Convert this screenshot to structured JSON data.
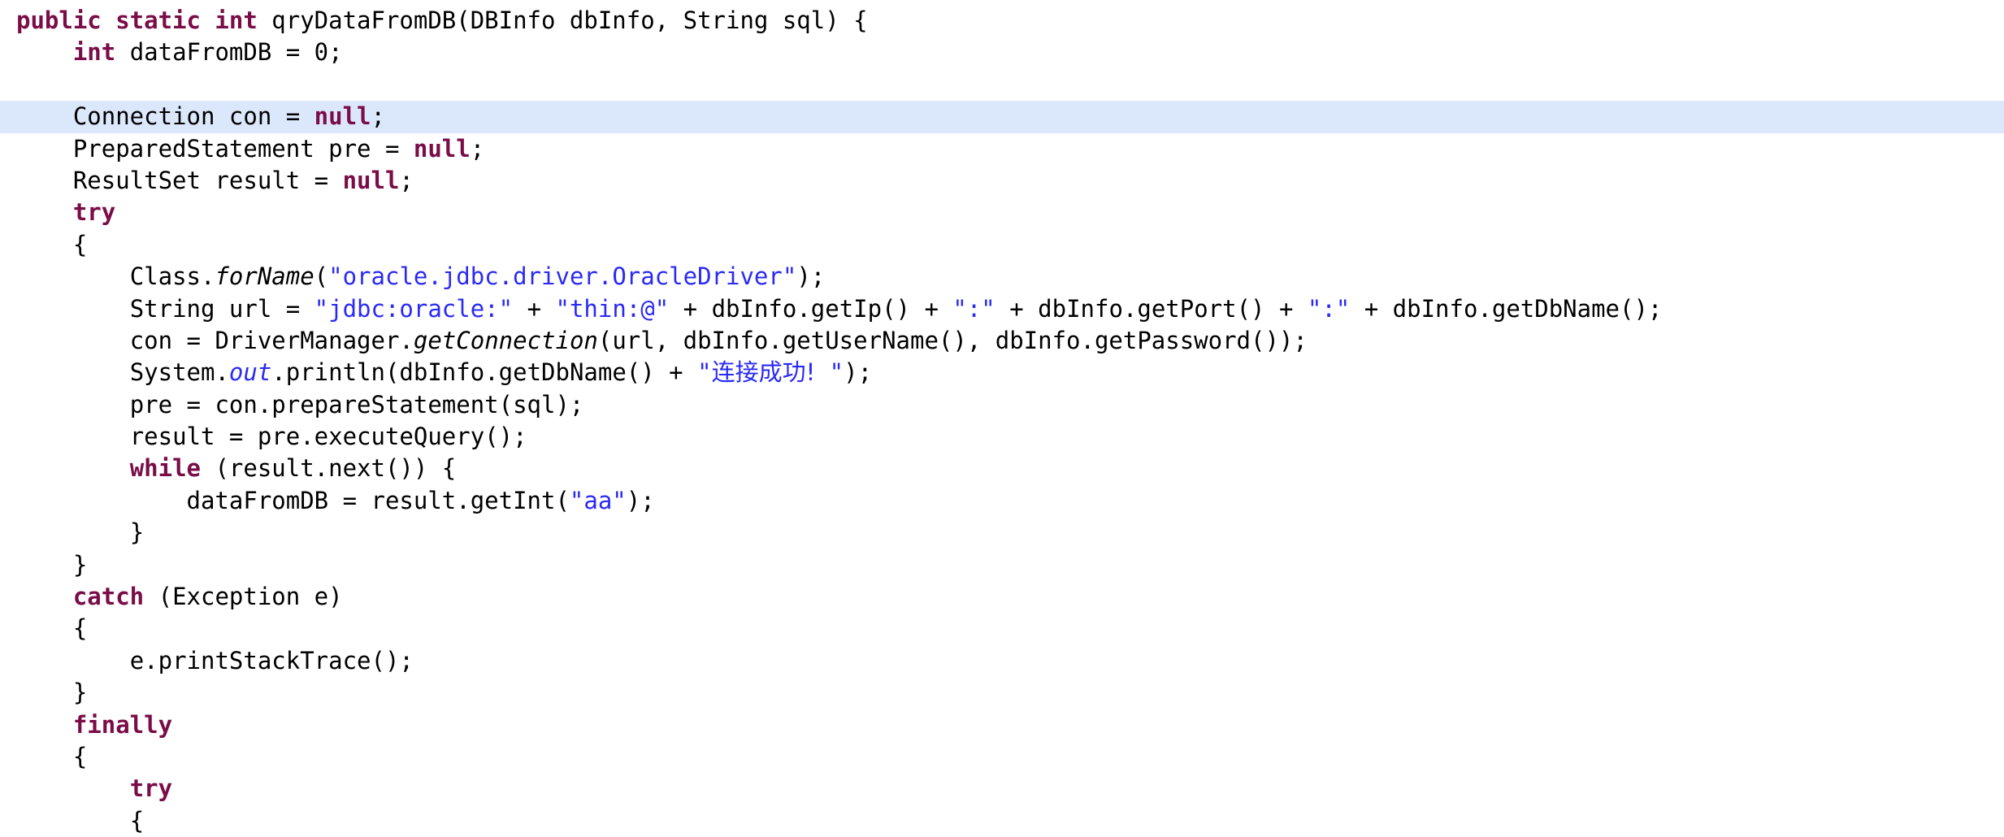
{
  "editor": {
    "language": "Java",
    "method_name": "qryDataFromDB",
    "highlight_color": "#dbe8fb",
    "keyword_color": "#7a0d48",
    "string_color": "#2a2af5",
    "text_color": "#000000",
    "background_color": "#ffffff",
    "highlighted_line_index": 3
  },
  "code": {
    "lines": [
      {
        "index": 0,
        "indent": 0,
        "highlighted": false,
        "segments": [
          {
            "type": "kw",
            "text": "public static int "
          },
          {
            "type": "plain",
            "text": "qryDataFromDB(DBInfo dbInfo, String sql) {"
          }
        ]
      },
      {
        "index": 1,
        "indent": 1,
        "highlighted": false,
        "segments": [
          {
            "type": "kw",
            "text": "int "
          },
          {
            "type": "plain",
            "text": "dataFromDB = 0;"
          }
        ]
      },
      {
        "index": 2,
        "indent": 0,
        "highlighted": false,
        "segments": [
          {
            "type": "plain",
            "text": ""
          }
        ]
      },
      {
        "index": 3,
        "indent": 1,
        "highlighted": true,
        "segments": [
          {
            "type": "plain",
            "text": "Connection con = "
          },
          {
            "type": "kw",
            "text": "null"
          },
          {
            "type": "plain",
            "text": ";"
          }
        ]
      },
      {
        "index": 4,
        "indent": 1,
        "highlighted": false,
        "segments": [
          {
            "type": "plain",
            "text": "PreparedStatement pre = "
          },
          {
            "type": "kw",
            "text": "null"
          },
          {
            "type": "plain",
            "text": ";"
          }
        ]
      },
      {
        "index": 5,
        "indent": 1,
        "highlighted": false,
        "segments": [
          {
            "type": "plain",
            "text": "ResultSet result = "
          },
          {
            "type": "kw",
            "text": "null"
          },
          {
            "type": "plain",
            "text": ";"
          }
        ]
      },
      {
        "index": 6,
        "indent": 1,
        "highlighted": false,
        "segments": [
          {
            "type": "kw",
            "text": "try"
          }
        ]
      },
      {
        "index": 7,
        "indent": 1,
        "highlighted": false,
        "segments": [
          {
            "type": "plain",
            "text": "{"
          }
        ]
      },
      {
        "index": 8,
        "indent": 2,
        "highlighted": false,
        "segments": [
          {
            "type": "plain",
            "text": "Class."
          },
          {
            "type": "method-italic",
            "text": "forName"
          },
          {
            "type": "plain",
            "text": "("
          },
          {
            "type": "str",
            "text": "\"oracle.jdbc.driver.OracleDriver\""
          },
          {
            "type": "plain",
            "text": ");"
          }
        ]
      },
      {
        "index": 9,
        "indent": 2,
        "highlighted": false,
        "segments": [
          {
            "type": "plain",
            "text": "String url = "
          },
          {
            "type": "str",
            "text": "\"jdbc:oracle:\""
          },
          {
            "type": "plain",
            "text": " + "
          },
          {
            "type": "str",
            "text": "\"thin:@\""
          },
          {
            "type": "plain",
            "text": " + dbInfo.getIp() + "
          },
          {
            "type": "str",
            "text": "\":\""
          },
          {
            "type": "plain",
            "text": " + dbInfo.getPort() + "
          },
          {
            "type": "str",
            "text": "\":\""
          },
          {
            "type": "plain",
            "text": " + dbInfo.getDbName();"
          }
        ]
      },
      {
        "index": 10,
        "indent": 2,
        "highlighted": false,
        "segments": [
          {
            "type": "plain",
            "text": "con = DriverManager."
          },
          {
            "type": "method-italic",
            "text": "getConnection"
          },
          {
            "type": "plain",
            "text": "(url, dbInfo.getUserName(), dbInfo.getPassword());"
          }
        ]
      },
      {
        "index": 11,
        "indent": 2,
        "highlighted": false,
        "segments": [
          {
            "type": "plain",
            "text": "System."
          },
          {
            "type": "static",
            "text": "out"
          },
          {
            "type": "plain",
            "text": ".println(dbInfo.getDbName() + "
          },
          {
            "type": "str",
            "text": "\""
          },
          {
            "type": "cjk",
            "text": "连接成功!"
          },
          {
            "type": "str",
            "text": " \""
          },
          {
            "type": "plain",
            "text": ");"
          }
        ]
      },
      {
        "index": 12,
        "indent": 2,
        "highlighted": false,
        "segments": [
          {
            "type": "plain",
            "text": "pre = con.prepareStatement(sql);"
          }
        ]
      },
      {
        "index": 13,
        "indent": 2,
        "highlighted": false,
        "segments": [
          {
            "type": "plain",
            "text": "result = pre.executeQuery();"
          }
        ]
      },
      {
        "index": 14,
        "indent": 2,
        "highlighted": false,
        "segments": [
          {
            "type": "kw",
            "text": "while"
          },
          {
            "type": "plain",
            "text": " (result.next()) {"
          }
        ]
      },
      {
        "index": 15,
        "indent": 3,
        "highlighted": false,
        "segments": [
          {
            "type": "plain",
            "text": "dataFromDB = result.getInt("
          },
          {
            "type": "str",
            "text": "\"aa\""
          },
          {
            "type": "plain",
            "text": ");"
          }
        ]
      },
      {
        "index": 16,
        "indent": 2,
        "highlighted": false,
        "segments": [
          {
            "type": "plain",
            "text": "}"
          }
        ]
      },
      {
        "index": 17,
        "indent": 1,
        "highlighted": false,
        "segments": [
          {
            "type": "plain",
            "text": "}"
          }
        ]
      },
      {
        "index": 18,
        "indent": 1,
        "highlighted": false,
        "segments": [
          {
            "type": "kw",
            "text": "catch"
          },
          {
            "type": "plain",
            "text": " (Exception e)"
          }
        ]
      },
      {
        "index": 19,
        "indent": 1,
        "highlighted": false,
        "segments": [
          {
            "type": "plain",
            "text": "{"
          }
        ]
      },
      {
        "index": 20,
        "indent": 2,
        "highlighted": false,
        "segments": [
          {
            "type": "plain",
            "text": "e.printStackTrace();"
          }
        ]
      },
      {
        "index": 21,
        "indent": 1,
        "highlighted": false,
        "segments": [
          {
            "type": "plain",
            "text": "}"
          }
        ]
      },
      {
        "index": 22,
        "indent": 1,
        "highlighted": false,
        "segments": [
          {
            "type": "kw",
            "text": "finally"
          }
        ]
      },
      {
        "index": 23,
        "indent": 1,
        "highlighted": false,
        "segments": [
          {
            "type": "plain",
            "text": "{"
          }
        ]
      },
      {
        "index": 24,
        "indent": 2,
        "highlighted": false,
        "segments": [
          {
            "type": "kw",
            "text": "try"
          }
        ]
      },
      {
        "index": 25,
        "indent": 2,
        "highlighted": false,
        "segments": [
          {
            "type": "plain",
            "text": "{"
          }
        ]
      }
    ]
  }
}
